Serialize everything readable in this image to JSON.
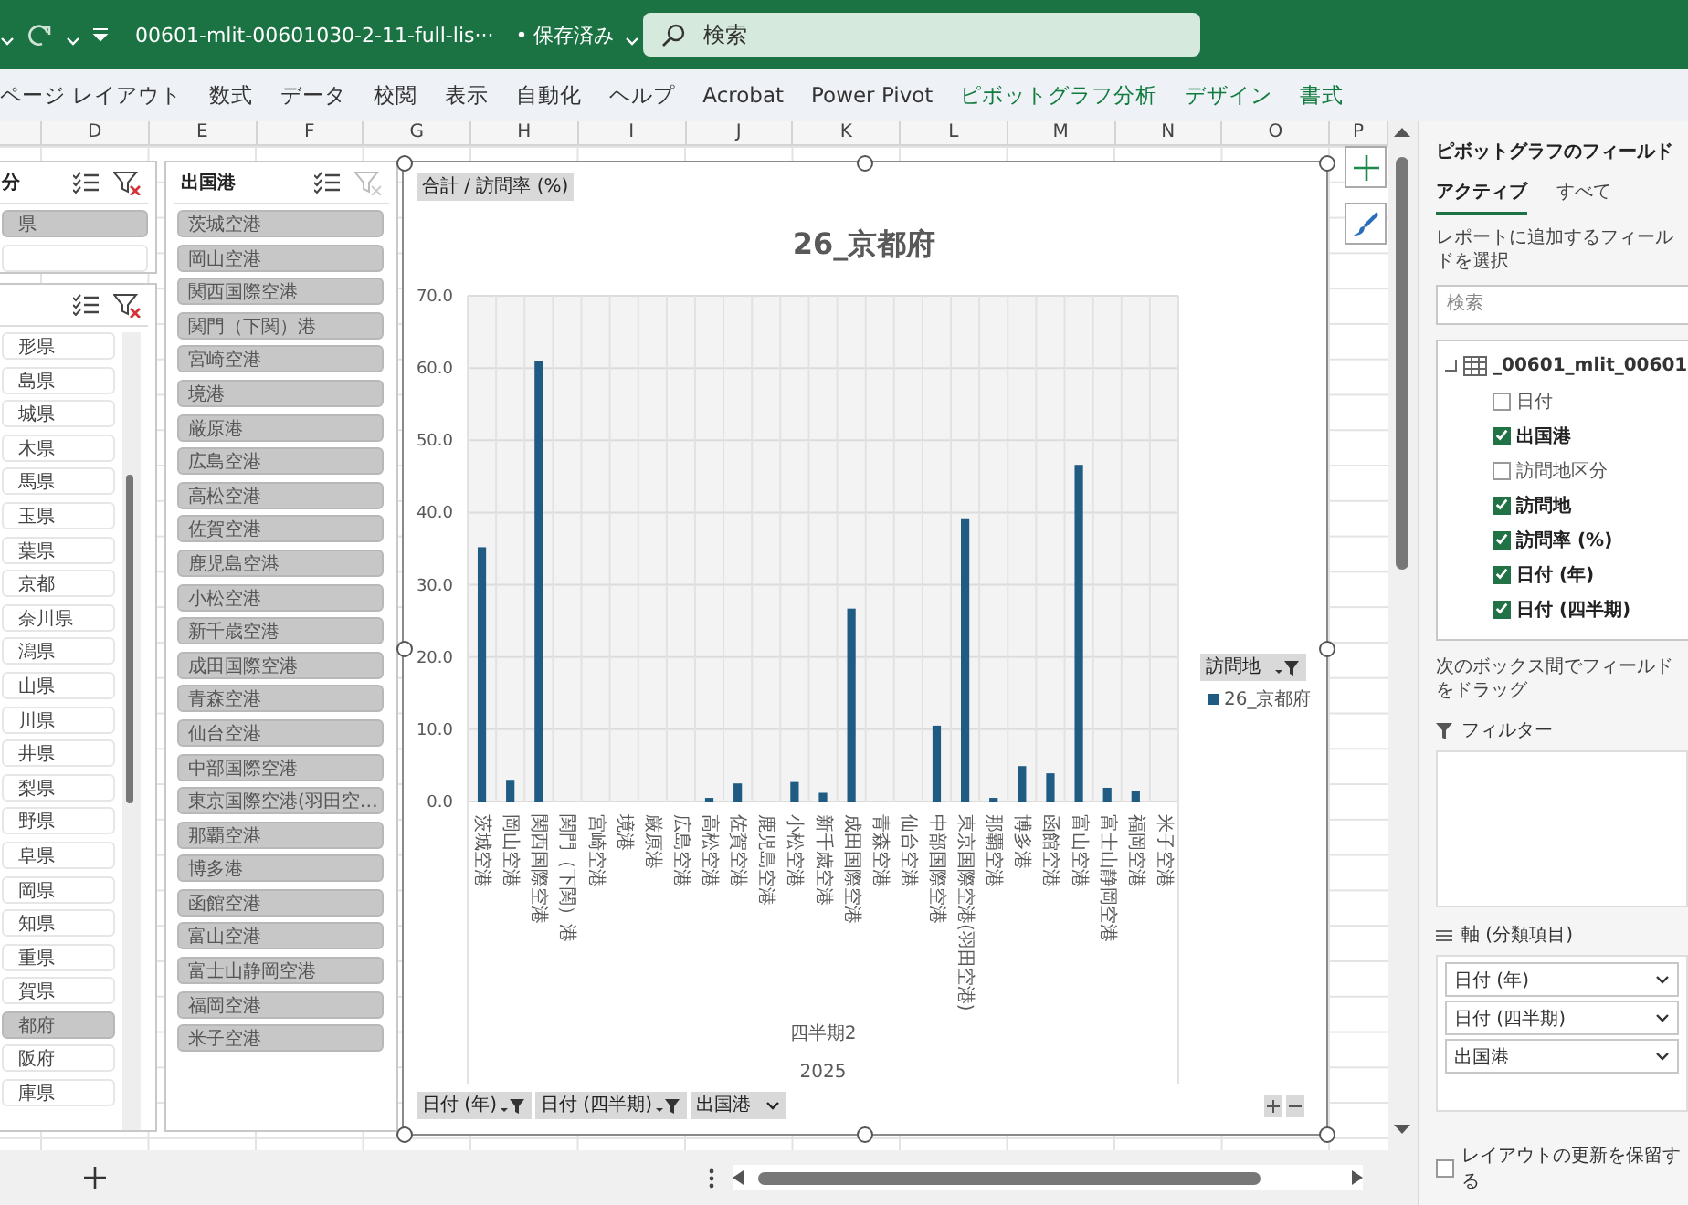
{
  "titlebar": {
    "file_name": "00601-mlit-00601030-2-11-full-lis···",
    "save_status": "• 保存済み",
    "search": {
      "placeholder": "検索"
    }
  },
  "ribbon_tabs": [
    {
      "label": "ページ レイアウト",
      "contextual": false
    },
    {
      "label": "数式",
      "contextual": false
    },
    {
      "label": "データ",
      "contextual": false
    },
    {
      "label": "校閲",
      "contextual": false
    },
    {
      "label": "表示",
      "contextual": false
    },
    {
      "label": "自動化",
      "contextual": false
    },
    {
      "label": "ヘルプ",
      "contextual": false
    },
    {
      "label": "Acrobat",
      "contextual": false
    },
    {
      "label": "Power Pivot",
      "contextual": false
    },
    {
      "label": "ピボットグラフ分析",
      "contextual": true
    },
    {
      "label": "デザイン",
      "contextual": true
    },
    {
      "label": "書式",
      "contextual": true
    }
  ],
  "column_headers": [
    "D",
    "E",
    "F",
    "G",
    "H",
    "I",
    "J",
    "K",
    "L",
    "M",
    "N",
    "O",
    "P"
  ],
  "slicers": [
    {
      "title": "分",
      "filtered": true,
      "items": [
        {
          "label": "県",
          "selected": true
        },
        {
          "selected": false
        }
      ]
    },
    {
      "filtered": true,
      "scrollbar": true,
      "items": [
        {
          "label": "形県",
          "selected": false
        },
        {
          "label": "島県",
          "selected": false
        },
        {
          "label": "城県",
          "selected": false
        },
        {
          "label": "木県",
          "selected": false
        },
        {
          "label": "馬県",
          "selected": false
        },
        {
          "label": "玉県",
          "selected": false
        },
        {
          "label": "葉県",
          "selected": false
        },
        {
          "label": "京都",
          "selected": false
        },
        {
          "label": "奈川県",
          "selected": false
        },
        {
          "label": "潟県",
          "selected": false
        },
        {
          "label": "山県",
          "selected": false
        },
        {
          "label": "川県",
          "selected": false
        },
        {
          "label": "井県",
          "selected": false
        },
        {
          "label": "梨県",
          "selected": false
        },
        {
          "label": "野県",
          "selected": false
        },
        {
          "label": "阜県",
          "selected": false
        },
        {
          "label": "岡県",
          "selected": false
        },
        {
          "label": "知県",
          "selected": false
        },
        {
          "label": "重県",
          "selected": false
        },
        {
          "label": "賀県",
          "selected": false
        },
        {
          "label": "都府",
          "selected": true
        },
        {
          "label": "阪府",
          "selected": false
        },
        {
          "label": "庫県",
          "selected": false
        }
      ]
    },
    {
      "title": "出国港",
      "filtered": false,
      "items": [
        {
          "label": "茨城空港",
          "selected": true
        },
        {
          "label": "岡山空港",
          "selected": true
        },
        {
          "label": "関西国際空港",
          "selected": true
        },
        {
          "label": "関門（下関）港",
          "selected": true
        },
        {
          "label": "宮崎空港",
          "selected": true
        },
        {
          "label": "境港",
          "selected": true
        },
        {
          "label": "厳原港",
          "selected": true
        },
        {
          "label": "広島空港",
          "selected": true
        },
        {
          "label": "高松空港",
          "selected": true
        },
        {
          "label": "佐賀空港",
          "selected": true
        },
        {
          "label": "鹿児島空港",
          "selected": true
        },
        {
          "label": "小松空港",
          "selected": true
        },
        {
          "label": "新千歳空港",
          "selected": true
        },
        {
          "label": "成田国際空港",
          "selected": true
        },
        {
          "label": "青森空港",
          "selected": true
        },
        {
          "label": "仙台空港",
          "selected": true
        },
        {
          "label": "中部国際空港",
          "selected": true
        },
        {
          "label": "東京国際空港(羽田空…",
          "selected": true
        },
        {
          "label": "那覇空港",
          "selected": true
        },
        {
          "label": "博多港",
          "selected": true
        },
        {
          "label": "函館空港",
          "selected": true
        },
        {
          "label": "富山空港",
          "selected": true
        },
        {
          "label": "富士山静岡空港",
          "selected": true
        },
        {
          "label": "福岡空港",
          "selected": true
        },
        {
          "label": "米子空港",
          "selected": true
        }
      ]
    }
  ],
  "chart": {
    "value_field_button": "合計 / 訪問率 (%)",
    "legend": {
      "field_button": "訪問地"
    },
    "axis_groups": [
      "四半期2",
      "2025"
    ],
    "field_buttons": [
      {
        "label": "日付 (年)",
        "filtered": true
      },
      {
        "label": "日付 (四半期)",
        "filtered": true
      },
      {
        "label": "出国港",
        "filtered": false
      }
    ],
    "chart_data": {
      "type": "bar",
      "title": "26_京都府",
      "grid": true,
      "categories": [
        "茨城空港",
        "岡山空港",
        "関西国際空港",
        "関門（下関）港",
        "宮崎空港",
        "境港",
        "厳原港",
        "広島空港",
        "高松空港",
        "佐賀空港",
        "鹿児島空港",
        "小松空港",
        "新千歳空港",
        "成田国際空港",
        "青森空港",
        "仙台空港",
        "中部国際空港",
        "東京国際空港(羽田空港)",
        "那覇空港",
        "博多港",
        "函館空港",
        "富山空港",
        "富士山静岡空港",
        "福岡空港",
        "米子空港"
      ],
      "series": [
        {
          "name": "26_京都府",
          "color": "#1f5b82",
          "values": [
            35.2,
            3.0,
            61.0,
            0,
            0,
            0,
            0,
            0,
            0.5,
            2.5,
            0,
            2.7,
            1.2,
            26.7,
            0,
            0,
            10.5,
            39.2,
            0.5,
            4.9,
            3.9,
            46.6,
            1.9,
            1.5,
            0
          ]
        }
      ],
      "ylim": [
        0,
        70
      ],
      "yticks": [
        {
          "value": 0,
          "label": "0.0"
        },
        {
          "value": 10,
          "label": "10.0"
        },
        {
          "value": 20,
          "label": "20.0"
        },
        {
          "value": 30,
          "label": "30.0"
        },
        {
          "value": 40,
          "label": "40.0"
        },
        {
          "value": 50,
          "label": "50.0"
        },
        {
          "value": 60,
          "label": "60.0"
        },
        {
          "value": 70,
          "label": "70.0"
        }
      ]
    }
  },
  "field_panel": {
    "title": "ピボットグラフのフィールド",
    "tabs": [
      {
        "label": "アクティブ",
        "selected": true
      },
      {
        "label": "すべて",
        "selected": false
      }
    ],
    "instruction": "レポートに追加するフィールドを選択",
    "search": {
      "placeholder": "検索"
    },
    "table": {
      "name": "_00601_mlit_00601",
      "expanded": true,
      "children": [
        {
          "label": "日付",
          "checked": false
        },
        {
          "label": "出国港",
          "checked": true
        },
        {
          "label": "訪問地区分",
          "checked": false
        },
        {
          "label": "訪問地",
          "checked": true
        },
        {
          "label": "訪問率 (%)",
          "checked": true
        },
        {
          "label": "日付 (年)",
          "checked": true
        },
        {
          "label": "日付 (四半期)",
          "checked": true
        }
      ]
    },
    "areas_instruction": "次のボックス間でフィールドをドラッグ",
    "areas": [
      {
        "kind": "filter",
        "label": "フィルター"
      },
      {
        "kind": "axis",
        "label": "軸 (分類項目)",
        "fields": [
          "日付 (年)",
          "日付 (四半期)",
          "出国港"
        ]
      }
    ],
    "defer_update": {
      "label": "レイアウトの更新を保留する",
      "checked": false
    }
  }
}
